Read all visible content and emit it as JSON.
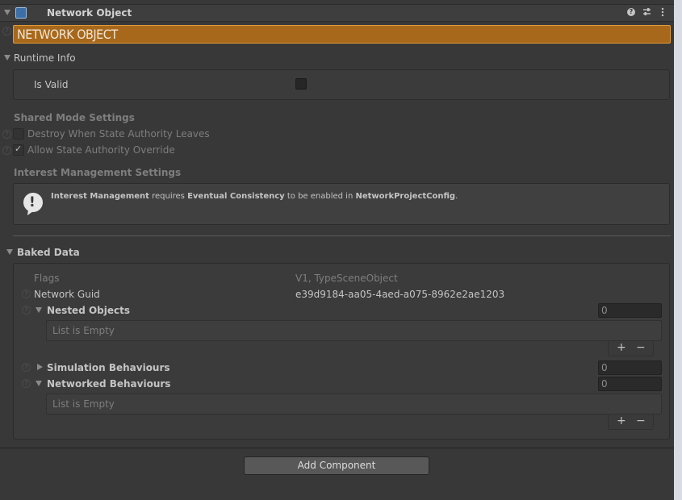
{
  "header": {
    "title": "Network Object",
    "icons": [
      "help-icon",
      "preset-icon",
      "kebab-menu-icon"
    ]
  },
  "banner": {
    "label": "NETWORK OBJECT"
  },
  "runtime_info": {
    "title": "Runtime Info",
    "is_valid_label": "Is Valid",
    "is_valid": false
  },
  "shared_mode": {
    "title": "Shared Mode Settings",
    "destroy_label": "Destroy When State Authority Leaves",
    "destroy_checked": false,
    "allow_label": "Allow State Authority Override",
    "allow_checked": true,
    "check_glyph": "✓"
  },
  "interest": {
    "title": "Interest Management Settings",
    "icon_glyph": "!",
    "msg": {
      "a": "Interest Management",
      "b": " requires ",
      "c": "Eventual Consistency",
      "d": " to be enabled in ",
      "e": "NetworkProjectConfig",
      "f": "."
    }
  },
  "baked_data": {
    "title": "Baked Data",
    "flags_label": "Flags",
    "flags_value": "V1, TypeSceneObject",
    "guid_label": "Network Guid",
    "guid_value": "e39d9184-aa05-4aed-a075-8962e2ae1203",
    "nested": {
      "label": "Nested Objects",
      "count": "0",
      "empty_text": "List is Empty"
    },
    "simulation": {
      "label": "Simulation Behaviours",
      "count": "0"
    },
    "networked": {
      "label": "Networked Behaviours",
      "count": "0",
      "empty_text": "List is Empty"
    },
    "add_glyph": "+",
    "remove_glyph": "−"
  },
  "add_component": {
    "label": "Add Component"
  },
  "help_glyph": "?"
}
